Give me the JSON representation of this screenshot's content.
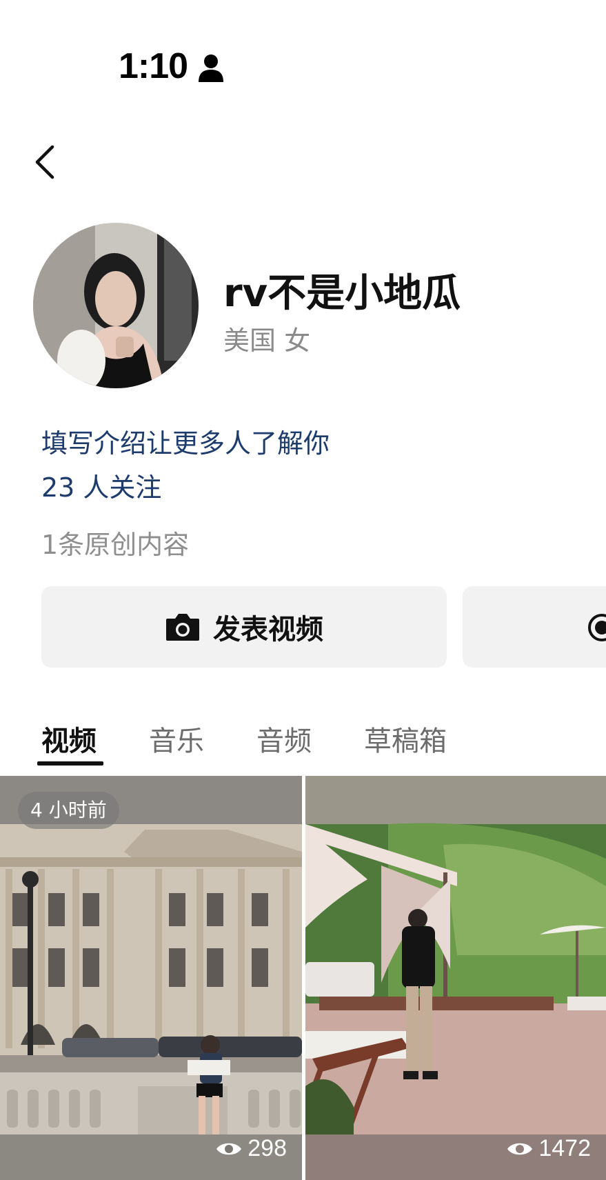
{
  "status_bar": {
    "time": "1:10",
    "icon": "person-icon"
  },
  "nav": {
    "back_icon": "chevron-left-icon"
  },
  "profile": {
    "name": "rv不是小地瓜",
    "meta": "美国 女",
    "intro": "填写介绍让更多人了解你",
    "followers": "23 人关注",
    "original_count": "1条原创内容"
  },
  "actions": {
    "post_video_label": "发表视频",
    "post_video_icon": "camera-icon",
    "second_icon": "record-icon"
  },
  "tabs": [
    {
      "label": "视频",
      "active": true
    },
    {
      "label": "音乐",
      "active": false
    },
    {
      "label": "音频",
      "active": false
    },
    {
      "label": "草稿箱",
      "active": false
    }
  ],
  "videos": [
    {
      "time_badge": "4 小时前",
      "views": "298",
      "scene": "classical building with woman sitting on balustrade"
    },
    {
      "time_badge": "",
      "views": "1472",
      "scene": "man walking past canopy cabana on terrace"
    }
  ],
  "colors": {
    "link": "#1d3b6c",
    "secondary_text": "#8a8a8a",
    "button_bg": "#f2f2f2"
  }
}
